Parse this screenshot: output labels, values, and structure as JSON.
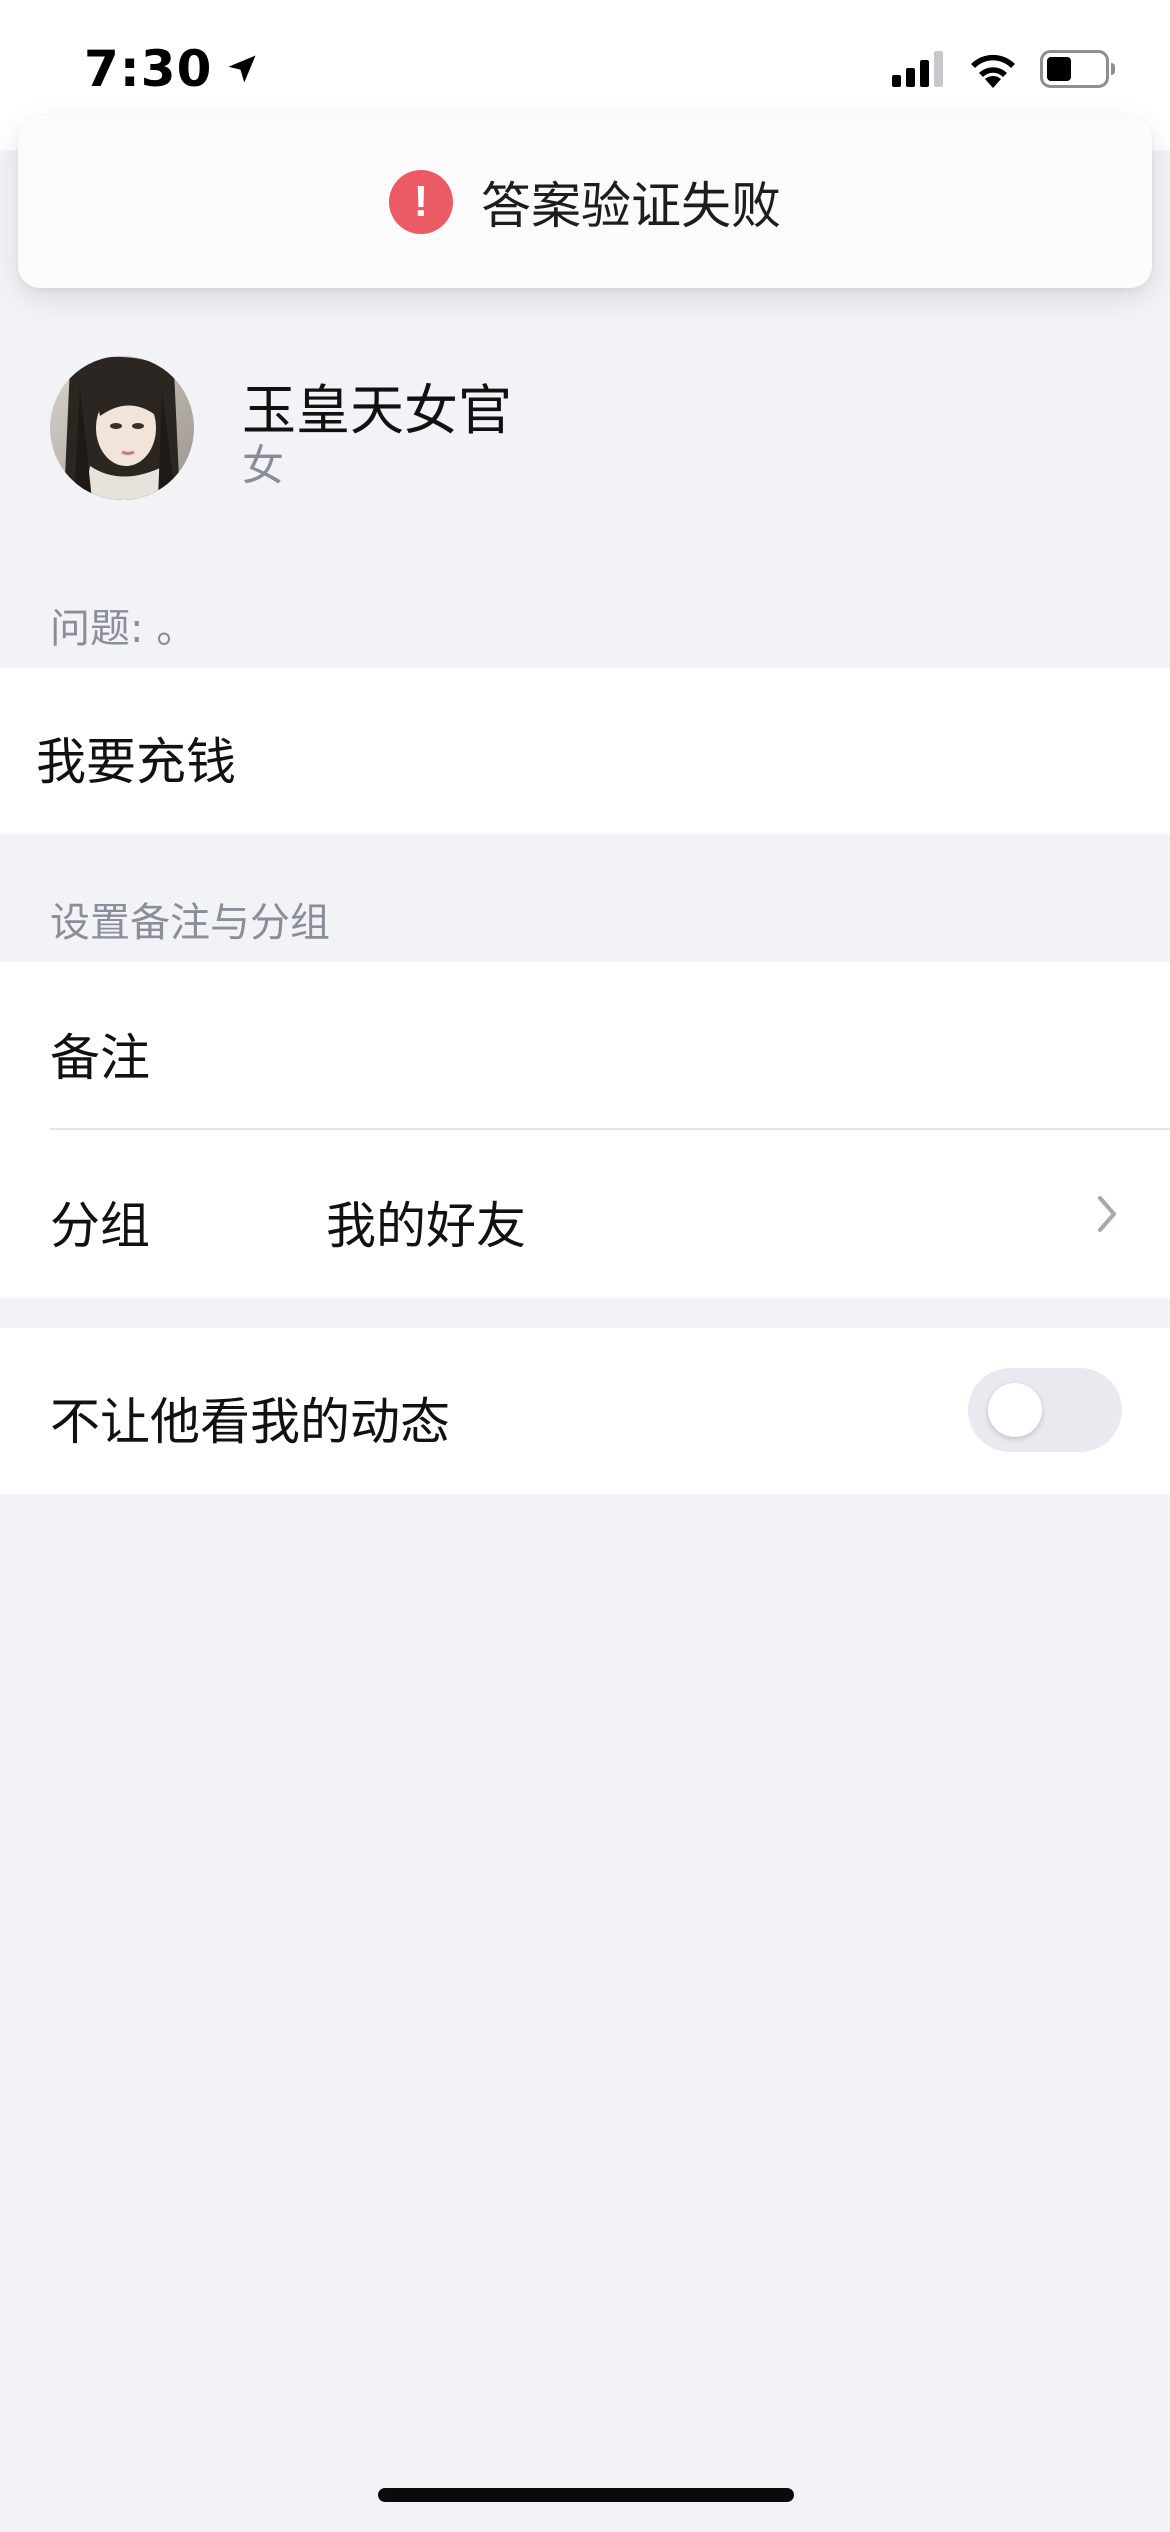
{
  "status_bar": {
    "time": "7:30",
    "icons": [
      "location-arrow-icon",
      "cellular-signal-icon",
      "wifi-icon",
      "battery-icon"
    ]
  },
  "toast": {
    "icon": "error-icon",
    "icon_glyph": "!",
    "text": "答案验证失败",
    "accent_color": "#ec5b65"
  },
  "profile": {
    "name": "玉皇天女官",
    "gender": "女"
  },
  "question": {
    "label": "问题: 。",
    "answer": "我要充钱"
  },
  "remark_group": {
    "section_title": "设置备注与分组",
    "remark_label": "备注",
    "group_label": "分组",
    "group_value": "我的好友"
  },
  "privacy": {
    "hide_moments_label": "不让他看我的动态",
    "hide_moments_enabled": false
  }
}
